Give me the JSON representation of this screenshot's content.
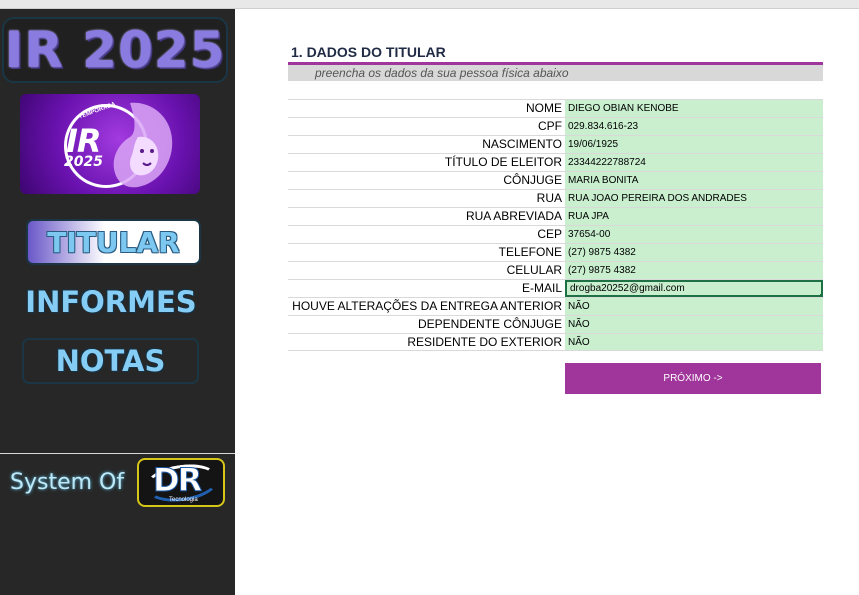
{
  "sidebar": {
    "title": "IR 2025",
    "badge": {
      "small_text": "TEMPORADA",
      "ir_text": "IR",
      "year_text": "2025",
      "icon": "lion-icon"
    },
    "nav": [
      {
        "label": "TITULAR"
      },
      {
        "label": "INFORMES"
      },
      {
        "label": "NOTAS"
      }
    ],
    "footer": {
      "text": "System Of",
      "logo_text": "DR",
      "logo_sub": "Tecnologia"
    }
  },
  "section": {
    "title": "1. DADOS DO TITULAR",
    "subtitle": "preencha os dados da sua pessoa física abaixo"
  },
  "fields": [
    {
      "label": "NOME",
      "value": "DIEGO  OBIAN KENOBE"
    },
    {
      "label": "CPF",
      "value": "029.834.616-23"
    },
    {
      "label": "NASCIMENTO",
      "value": "19/06/1925"
    },
    {
      "label": "TÍTULO DE ELEITOR",
      "value": "23344222788724"
    },
    {
      "label": "CÔNJUGE",
      "value": "MARIA BONITA"
    },
    {
      "label": "RUA",
      "value": "RUA JOAO PEREIRA DOS ANDRADES"
    },
    {
      "label": "RUA ABREVIADA",
      "value": "RUA JPA"
    },
    {
      "label": "CEP",
      "value": "37654-00"
    },
    {
      "label": "TELEFONE",
      "value": "(27) 9875 4382"
    },
    {
      "label": "CELULAR",
      "value": "(27) 9875 4382"
    },
    {
      "label": "E-MAIL",
      "value": "drogba20252@gmail.com"
    },
    {
      "label": "HOUVE ALTERAÇÕES DA ENTREGA ANTERIOR",
      "value": "NÃO"
    },
    {
      "label": "DEPENDENTE CÔNJUGE",
      "value": "NÃO"
    },
    {
      "label": "RESIDENTE DO EXTERIOR",
      "value": "NÃO"
    }
  ],
  "next_button": {
    "label": "PRÓXIMO ->"
  },
  "colors": {
    "accent": "#a0359c",
    "field_bg": "#c9efcf",
    "sidebar_bg": "#272727",
    "nav_text": "#85cdf5"
  }
}
